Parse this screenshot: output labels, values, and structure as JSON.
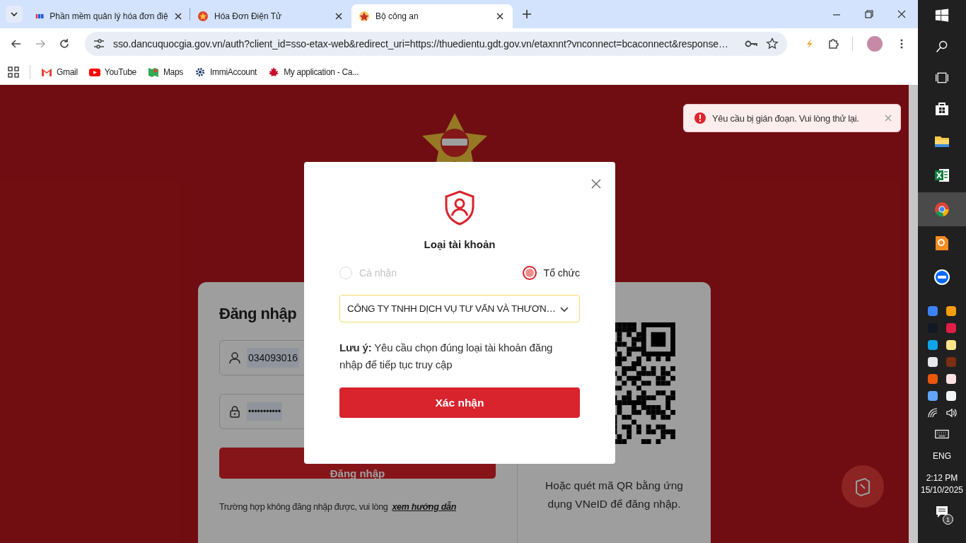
{
  "browser": {
    "tabs": [
      {
        "title": "Phần mềm quản lý hóa đơn điệ",
        "selected": false
      },
      {
        "title": "Hóa Đơn Điện Tử",
        "selected": false
      },
      {
        "title": "Bộ công an",
        "selected": true
      }
    ],
    "url": "sso.dancuquocgia.gov.vn/auth?client_id=sso-etax-web&redirect_uri=https://thuedientu.gdt.gov.vn/etaxnnt?vnconnect=bcaconnect&response…",
    "bookmarks": [
      {
        "label": "Gmail",
        "kind": "gmail"
      },
      {
        "label": "YouTube",
        "kind": "youtube"
      },
      {
        "label": "Maps",
        "kind": "maps"
      },
      {
        "label": "ImmiAccount",
        "kind": "gear"
      },
      {
        "label": "My application - Ca...",
        "kind": "leaf"
      }
    ]
  },
  "page": {
    "login": {
      "title": "Đăng nhập",
      "username": "034093016",
      "password": "•••••••••••",
      "login_button": "Đăng nhập",
      "help_text": "Trường hợp không đăng nhập được, vui lòng",
      "help_link": "xem hướng dẫn",
      "qr_caption": "Hoặc quét mã QR bằng ứng dụng VNeID để đăng nhập."
    },
    "toast": {
      "message": "Yêu cầu bị gián đoạn. Vui lòng thử lại."
    },
    "modal": {
      "title": "Loại tài khoản",
      "account_types": [
        {
          "label": "Cá nhân",
          "selected": false,
          "disabled": true
        },
        {
          "label": "Tổ chức",
          "selected": true,
          "disabled": false
        }
      ],
      "company": "CÔNG TY TNHH DỊCH VỤ TƯ VẤN VÀ THƯƠN…",
      "note": "**Lưu ý:** Yêu cầu chọn đúng loại tài khoản đăng nhập để tiếp tục truy cập",
      "confirm_button": "Xác nhận"
    }
  },
  "taskbar": {
    "language": "ENG",
    "time": "2:12 PM",
    "date": "15/10/2025",
    "notification_count": "1"
  }
}
